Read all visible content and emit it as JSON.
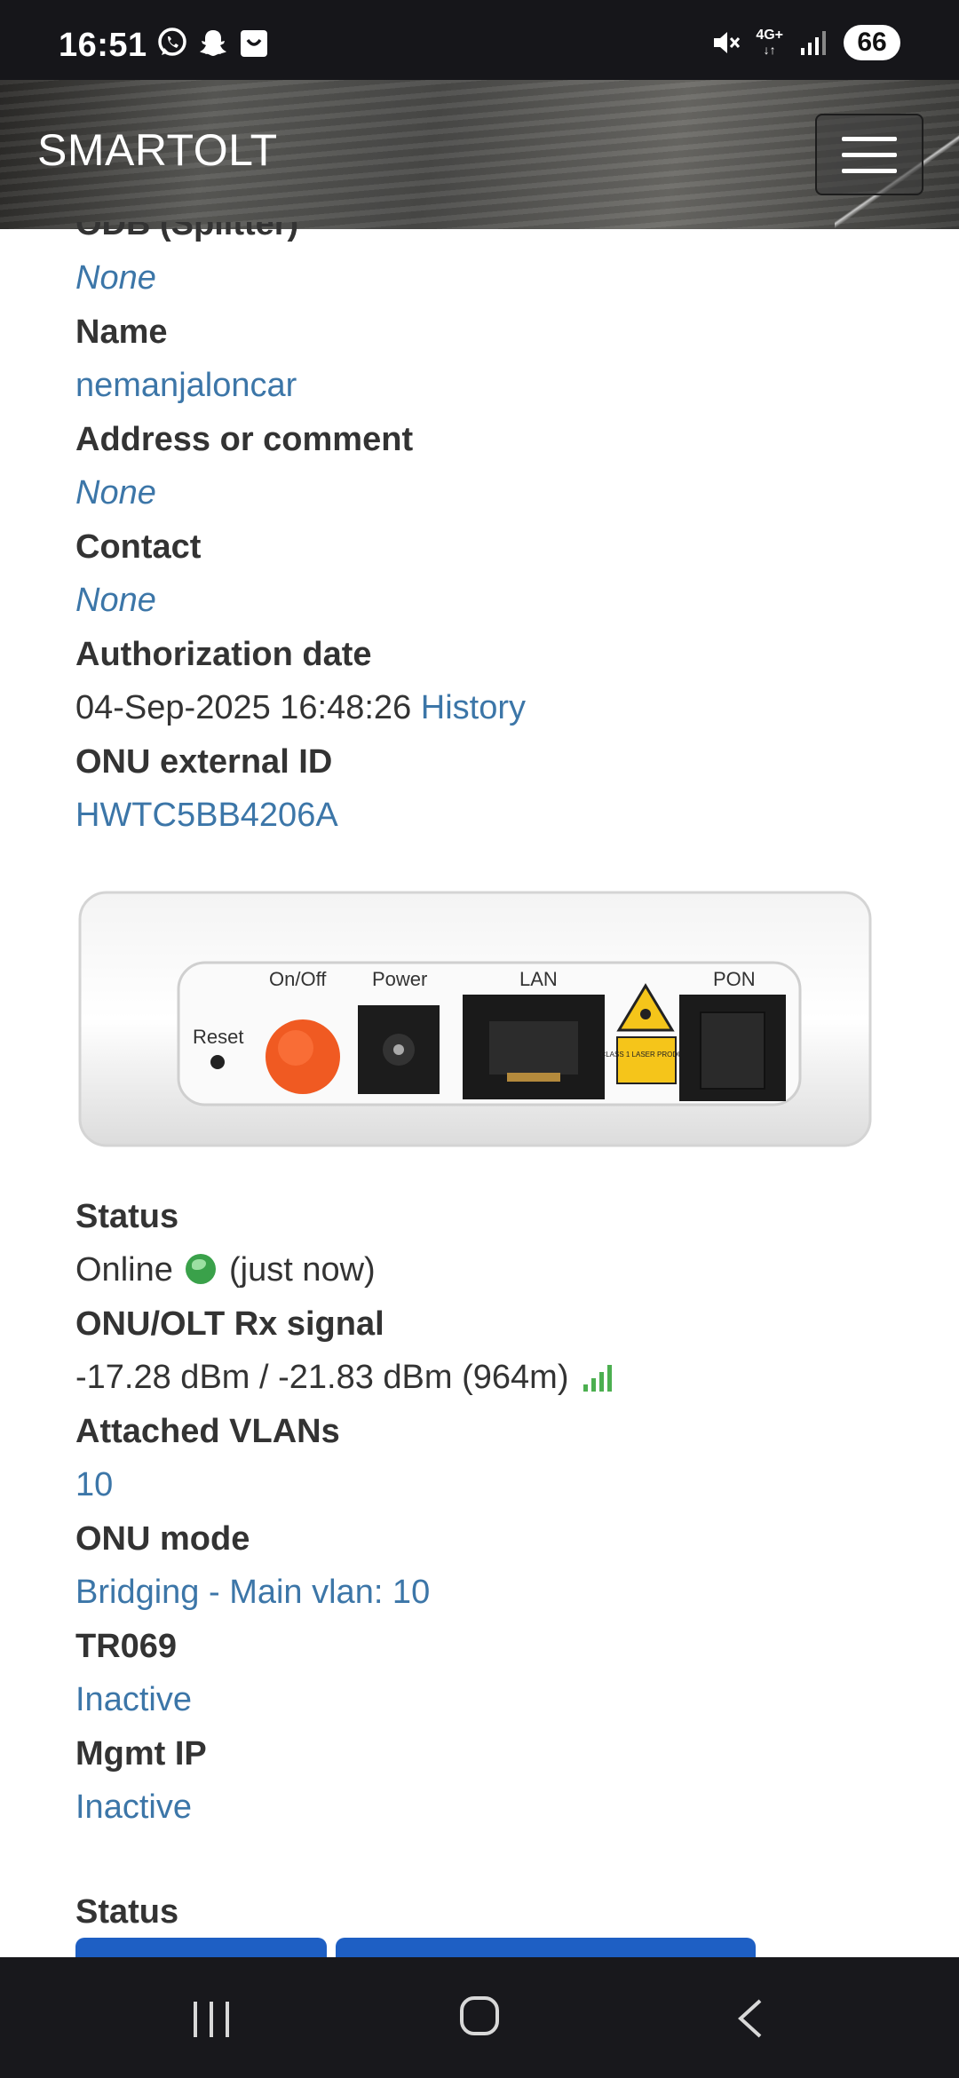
{
  "status_bar": {
    "time": "16:51",
    "left_icons": [
      "whatsapp-icon",
      "snapchat-icon",
      "shopping-bag-icon"
    ],
    "right_icons": [
      "mute-icon",
      "4g-signal-icon",
      "signal-bars-icon"
    ],
    "network_label": "4G+",
    "battery": "66"
  },
  "navbar": {
    "brand": "SMARTOLT",
    "menu_icon": "hamburger-menu-icon"
  },
  "details": {
    "odb_label": "ODB (Splitter)",
    "odb_value": "None",
    "name_label": "Name",
    "name_value": "nemanjaloncar",
    "address_label": "Address or comment",
    "address_value": "None",
    "contact_label": "Contact",
    "contact_value": "None",
    "auth_label": "Authorization date",
    "auth_value": "04-Sep-2025 16:48:26",
    "history_link": "History",
    "external_id_label": "ONU external ID",
    "external_id_value": "HWTC5BB4206A"
  },
  "device_image": {
    "labels": {
      "reset": "Reset",
      "onoff": "On/Off",
      "power": "Power",
      "lan": "LAN",
      "pon": "PON",
      "laser": "CLASS 1 LASER PRODUCT"
    }
  },
  "status_info": {
    "status_label": "Status",
    "status_value": "Online",
    "status_icon": "globe-icon",
    "status_time": "(just now)",
    "signal_label": "ONU/OLT Rx signal",
    "signal_value": "-17.28 dBm / -21.83 dBm (964m)",
    "signal_icon": "signal-strength-icon",
    "vlans_label": "Attached VLANs",
    "vlans_value": "10",
    "mode_label": "ONU mode",
    "mode_value": "Bridging - Main vlan: 10",
    "tr069_label": "TR069",
    "tr069_value": "Inactive",
    "mgmt_label": "Mgmt IP",
    "mgmt_value": "Inactive"
  },
  "status_section": {
    "heading": "Status"
  },
  "colors": {
    "link": "#3c76a8",
    "online": "#3aa14a",
    "button": "#1e5fc4"
  }
}
